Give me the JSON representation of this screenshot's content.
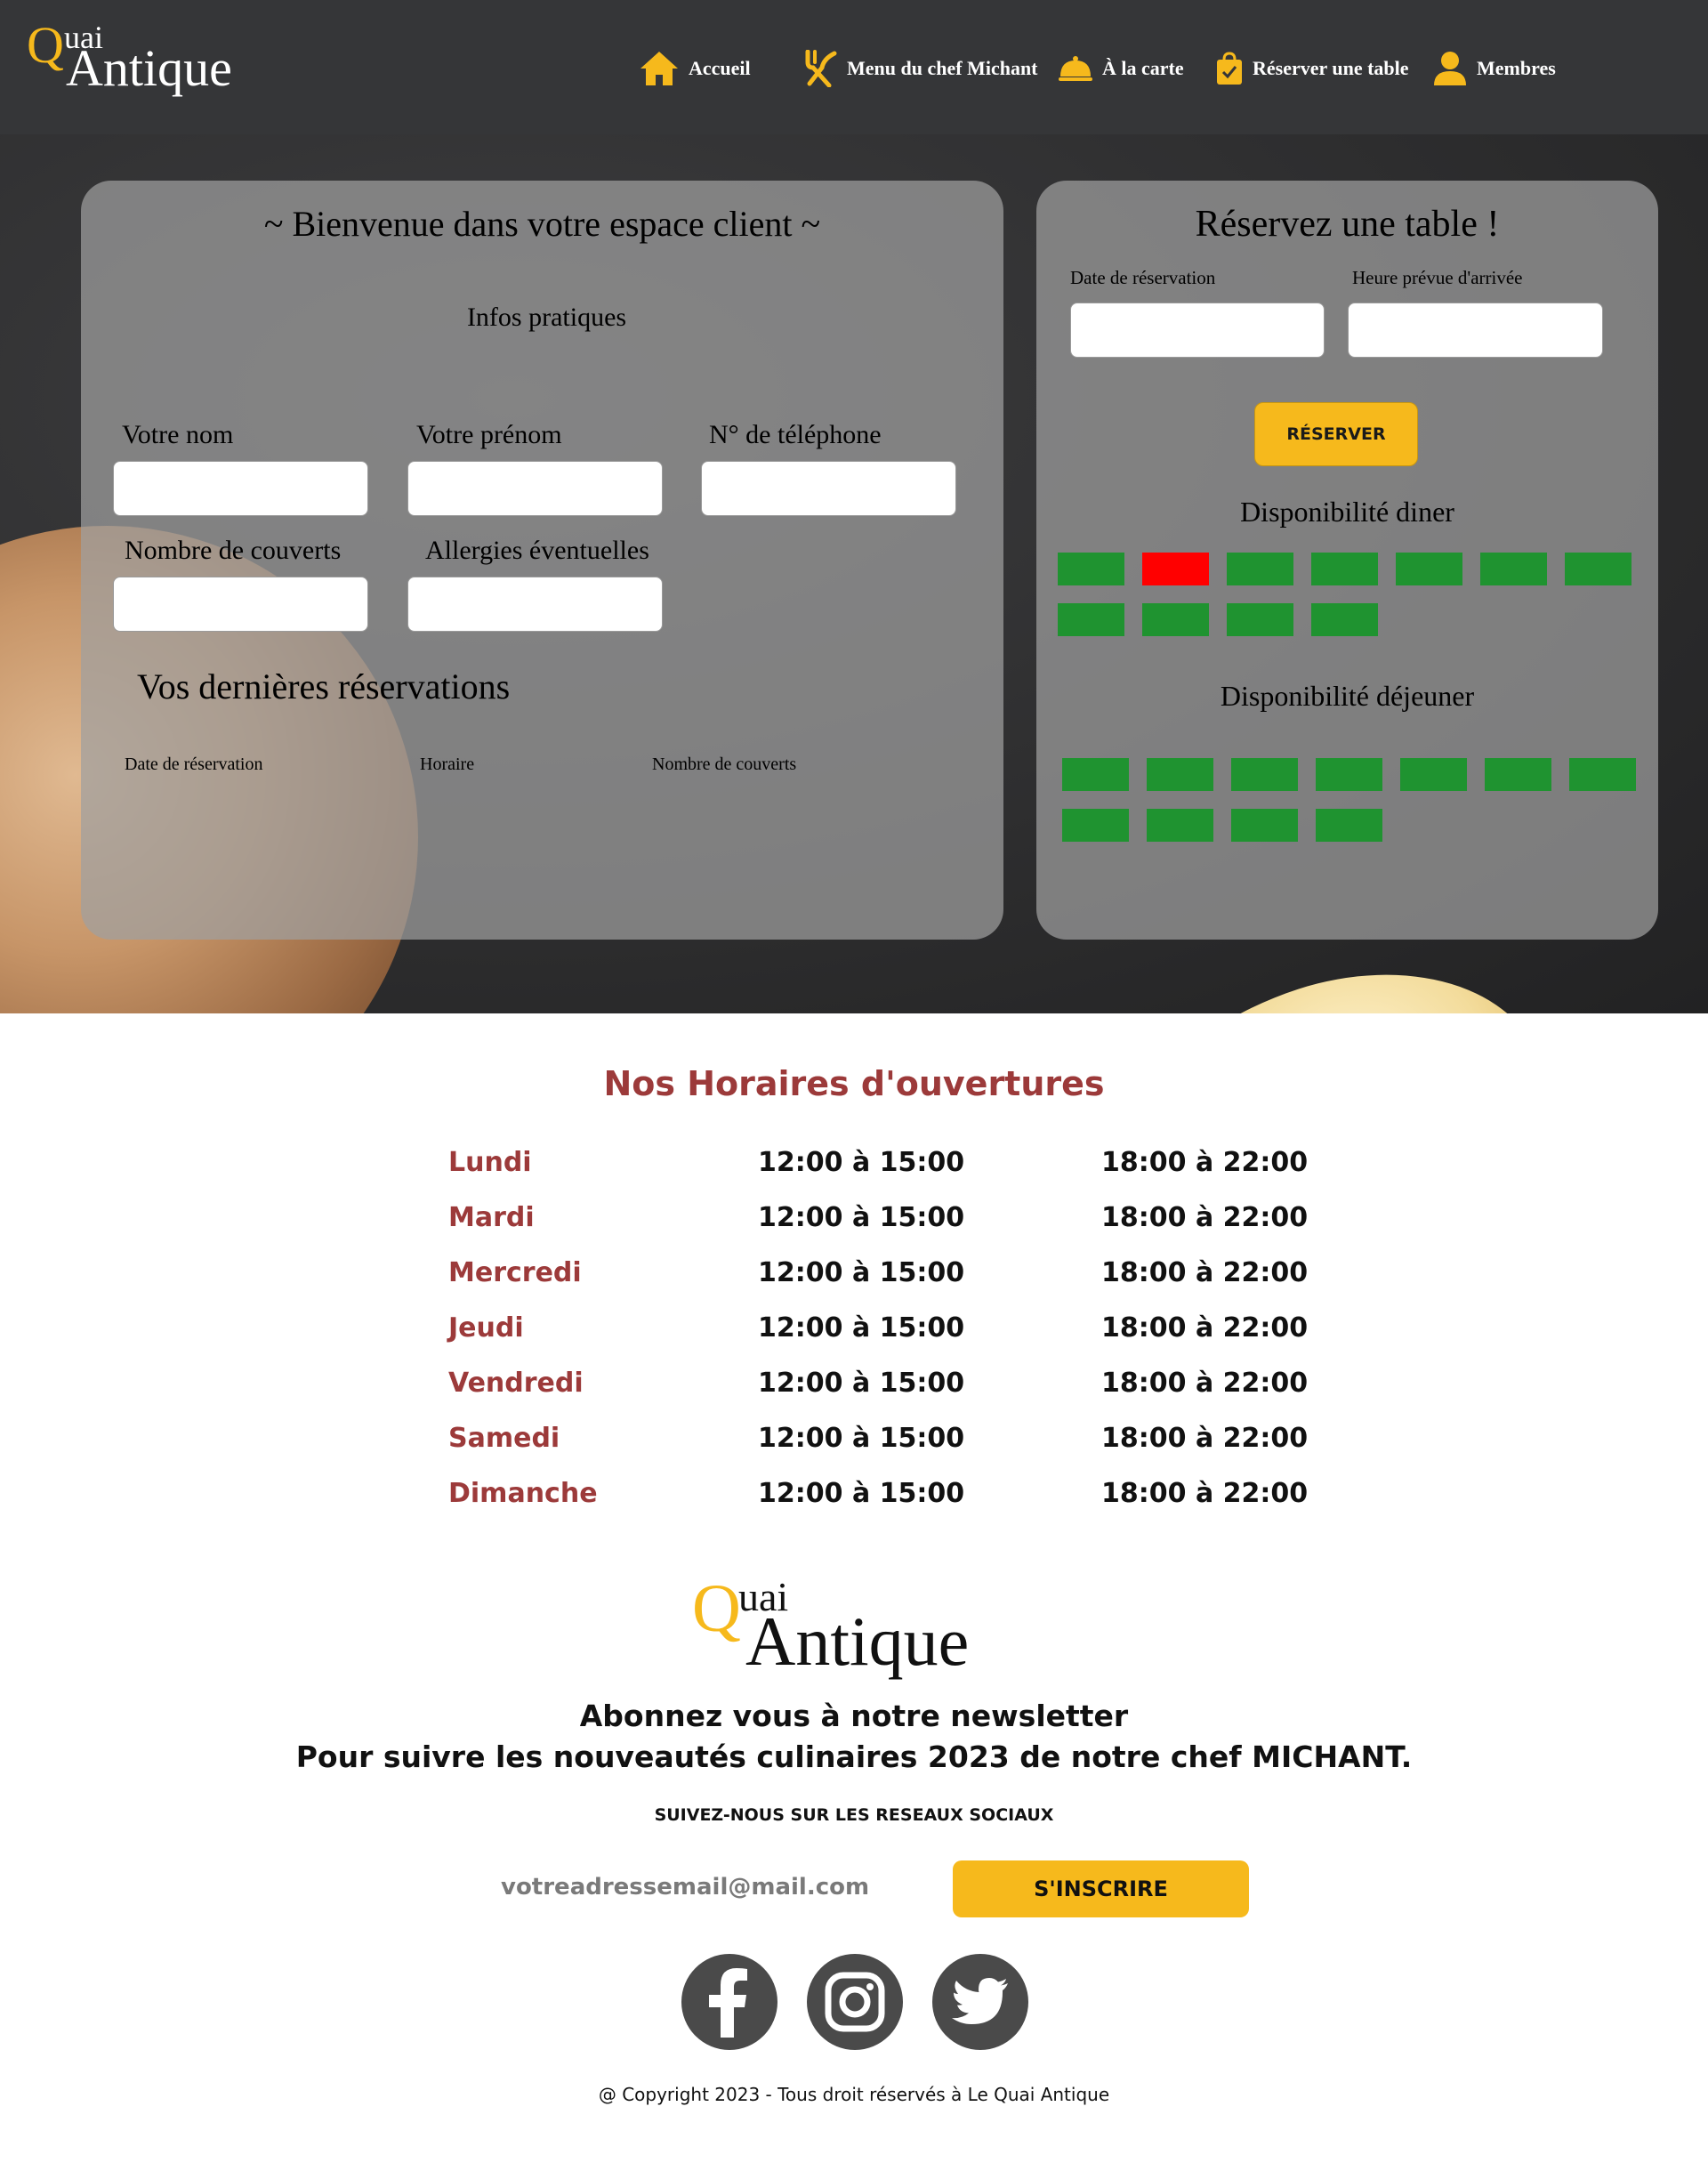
{
  "header": {
    "logo": {
      "q": "Q",
      "uai": "uai",
      "antique": "Antique"
    },
    "nav": [
      {
        "label": "Accueil",
        "icon": "home-icon"
      },
      {
        "label": "Menu du chef Michant",
        "icon": "utensils-icon"
      },
      {
        "label": "À la carte",
        "icon": "cloche-icon"
      },
      {
        "label": "Réserver une table",
        "icon": "bag-check-icon"
      },
      {
        "label": "Membres",
        "icon": "user-icon"
      }
    ]
  },
  "client_space": {
    "title": "~ Bienvenue dans votre espace client ~",
    "info_heading": "Infos pratiques",
    "fields": {
      "nom": "Votre nom",
      "prenom": "Votre prénom",
      "telephone": "N° de téléphone",
      "couverts": "Nombre de couverts",
      "allergies": "Allergies éventuelles"
    },
    "reservations_title": "Vos dernières réservations",
    "reservations_columns": [
      "Date de réservation",
      "Horaire",
      "Nombre de couverts"
    ]
  },
  "booking": {
    "title": "Réservez une table !",
    "date_label": "Date de réservation",
    "time_label": "Heure prévue d'arrivée",
    "button": "RÉSERVER",
    "dinner_title": "Disponibilité diner",
    "lunch_title": "Disponibilité déjeuner",
    "dinner_slots": [
      "available",
      "unavailable",
      "available",
      "available",
      "available",
      "available",
      "available",
      "available",
      "available",
      "available",
      "available"
    ],
    "lunch_slots": [
      "available",
      "available",
      "available",
      "available",
      "available",
      "available",
      "available",
      "available",
      "available",
      "available",
      "available"
    ],
    "colors": {
      "available": "#1f9330",
      "unavailable": "#ff0000"
    }
  },
  "hours": {
    "title": "Nos Horaires d'ouvertures",
    "rows": [
      {
        "day": "Lundi",
        "lunch": "12:00 à 15:00",
        "dinner": "18:00 à 22:00"
      },
      {
        "day": "Mardi",
        "lunch": "12:00 à 15:00",
        "dinner": "18:00 à 22:00"
      },
      {
        "day": "Mercredi",
        "lunch": "12:00 à 15:00",
        "dinner": "18:00 à 22:00"
      },
      {
        "day": "Jeudi",
        "lunch": "12:00 à 15:00",
        "dinner": "18:00 à 22:00"
      },
      {
        "day": "Vendredi",
        "lunch": "12:00 à 15:00",
        "dinner": "18:00 à 22:00"
      },
      {
        "day": "Samedi",
        "lunch": "12:00 à 15:00",
        "dinner": "18:00 à 22:00"
      },
      {
        "day": "Dimanche",
        "lunch": "12:00 à 15:00",
        "dinner": "18:00 à 22:00"
      }
    ]
  },
  "footer": {
    "logo": {
      "q": "Q",
      "uai": "uai",
      "antique": "Antique"
    },
    "newsletter_line1": "Abonnez vous à notre newsletter",
    "newsletter_line2": "Pour suivre les nouveautés culinaires 2023 de notre chef MICHANT.",
    "social_label": "SUIVEZ-NOUS SUR LES RESEAUX SOCIAUX",
    "email_placeholder": "votreadressemail@mail.com",
    "subscribe_button": "S'INSCRIRE",
    "socials": [
      "facebook-icon",
      "instagram-icon",
      "twitter-icon"
    ],
    "copyright": "@ Copyright 2023 - Tous droit réservés à  Le Quai Antique"
  },
  "colors": {
    "accent": "#f6b91c",
    "header_bg": "#353638",
    "hours_day": "#9c3a3a"
  }
}
